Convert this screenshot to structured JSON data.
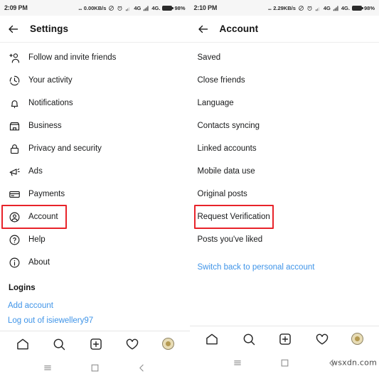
{
  "left": {
    "status_bar": {
      "time": "2:09 PM",
      "dots": "...",
      "network_speed": "0.00KB/s",
      "signal_label_1": "4G",
      "signal_label_2": "4G.",
      "battery_percent": "98%"
    },
    "header": {
      "title": "Settings",
      "back_icon": "back-arrow-icon"
    },
    "items": [
      {
        "label": "Follow and invite friends",
        "icon": "add-person-icon"
      },
      {
        "label": "Your activity",
        "icon": "clock-activity-icon"
      },
      {
        "label": "Notifications",
        "icon": "bell-icon"
      },
      {
        "label": "Business",
        "icon": "storefront-icon"
      },
      {
        "label": "Privacy and security",
        "icon": "lock-icon"
      },
      {
        "label": "Ads",
        "icon": "megaphone-icon"
      },
      {
        "label": "Payments",
        "icon": "credit-card-icon"
      },
      {
        "label": "Account",
        "icon": "account-circle-icon"
      },
      {
        "label": "Help",
        "icon": "question-circle-icon"
      },
      {
        "label": "About",
        "icon": "info-circle-icon"
      }
    ],
    "highlighted_item": "Account",
    "section_logins": "Logins",
    "links": [
      {
        "label": "Add account"
      },
      {
        "label": "Log out of isiewellery97"
      }
    ]
  },
  "right": {
    "status_bar": {
      "time": "2:10 PM",
      "dots": "...",
      "network_speed": "2.29KB/s",
      "signal_label_1": "4G",
      "signal_label_2": "4G.",
      "battery_percent": "98%"
    },
    "header": {
      "title": "Account",
      "back_icon": "back-arrow-icon"
    },
    "items": [
      {
        "label": "Saved"
      },
      {
        "label": "Close friends"
      },
      {
        "label": "Language"
      },
      {
        "label": "Contacts syncing"
      },
      {
        "label": "Linked accounts"
      },
      {
        "label": "Mobile data use"
      },
      {
        "label": "Original posts"
      },
      {
        "label": "Request Verification"
      },
      {
        "label": "Posts you've liked"
      }
    ],
    "highlighted_item": "Request Verification",
    "links": [
      {
        "label": "Switch back to personal account"
      }
    ]
  },
  "tabbar": {
    "items": [
      {
        "icon": "home-icon",
        "name": "tab-home"
      },
      {
        "icon": "search-icon",
        "name": "tab-search"
      },
      {
        "icon": "add-post-icon",
        "name": "tab-add-post"
      },
      {
        "icon": "heart-icon",
        "name": "tab-activity"
      },
      {
        "icon": "avatar-icon",
        "name": "tab-profile"
      }
    ]
  },
  "sysnav": {
    "items": [
      {
        "icon": "menu-recents-icon",
        "name": "sysnav-recents"
      },
      {
        "icon": "square-home-icon",
        "name": "sysnav-home"
      },
      {
        "icon": "chevron-back-icon",
        "name": "sysnav-back"
      }
    ]
  },
  "watermark": {
    "text": "wsxdn.com"
  },
  "colors": {
    "highlight": "#e8232a",
    "link": "#3f94e8",
    "text": "#18191a",
    "statusbar_bg": "#f6f6f6"
  }
}
